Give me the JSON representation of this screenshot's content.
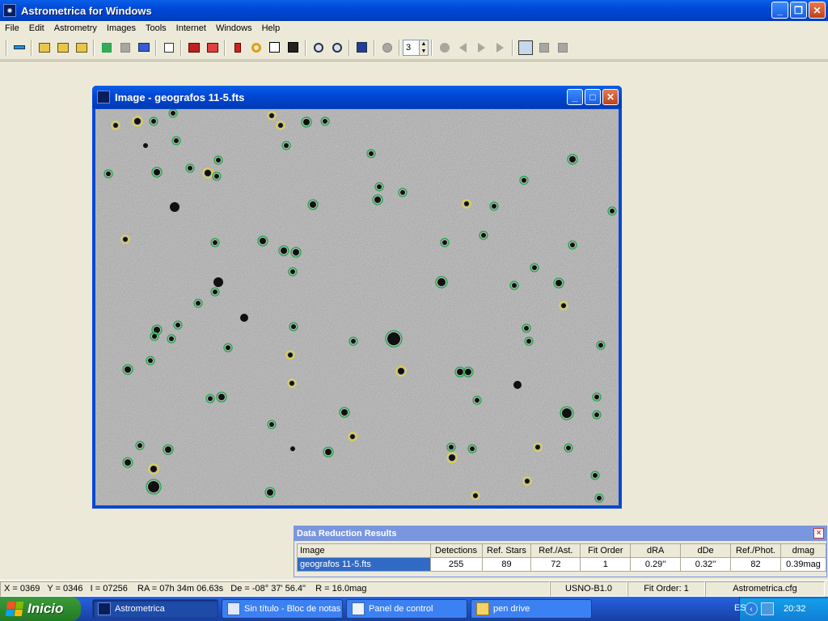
{
  "window": {
    "title": "Astrometrica for Windows",
    "minimize": "_",
    "restore": "❐",
    "close": "✕"
  },
  "menu": [
    "File",
    "Edit",
    "Astrometry",
    "Images",
    "Tools",
    "Internet",
    "Windows",
    "Help"
  ],
  "toolbar": {
    "icons": [
      "connect-icon",
      "open-image-icon",
      "open-folder-icon",
      "open-multiple-icon",
      "add-green-icon",
      "add-grey-icon",
      "stack-icon",
      "new-window-icon",
      "remove-red-icon",
      "delete-red-icon",
      "mark-icon",
      "ring-icon",
      "known-objects-icon",
      "blink-icon",
      "zoom-in-icon",
      "zoom-out-icon",
      "starmap-icon",
      "moving-object-icon",
      "play-dot-icon",
      "step-back-icon",
      "step-forward-icon",
      "play-icon",
      "magnify-icon",
      "grey-a-icon",
      "grey-b-icon"
    ],
    "spin_value": "3"
  },
  "image_window": {
    "title": "Image - geografos 11-5.fts",
    "colors": {
      "sky": "#a8a8a8",
      "green_marker": "#1ea64a",
      "yellow_marker": "#e8d832"
    }
  },
  "data_reduction": {
    "title": "Data Reduction Results",
    "close": "×",
    "headers": [
      "Image",
      "Detections",
      "Ref. Stars",
      "Ref./Ast.",
      "Fit Order",
      "dRA",
      "dDe",
      "Ref./Phot.",
      "dmag"
    ],
    "row": [
      "geografos 11-5.fts",
      "255",
      "89",
      "72",
      "1",
      "0.29''",
      "0.32''",
      "82",
      "0.39mag"
    ]
  },
  "status": {
    "coords": "X = 0369   Y = 0346   I = 07256    RA = 07h 34m 06.63s   De = -08° 37' 56.4\"    R = 16.0mag",
    "catalog": "USNO-B1.0",
    "fit_order": "Fit Order: 1",
    "config": "Astrometrica.cfg"
  },
  "taskbar": {
    "start": "Inicio",
    "tasks": [
      {
        "label": "Astrometrica",
        "active": true,
        "icon": "astrometrica-icon"
      },
      {
        "label": "Sin título - Bloc de notas",
        "active": false,
        "icon": "notepad-icon"
      },
      {
        "label": "Panel de control",
        "active": false,
        "icon": "control-panel-icon"
      },
      {
        "label": "pen drive",
        "active": false,
        "icon": "folder-icon"
      }
    ],
    "lang": "ES",
    "clock": "20:32"
  }
}
